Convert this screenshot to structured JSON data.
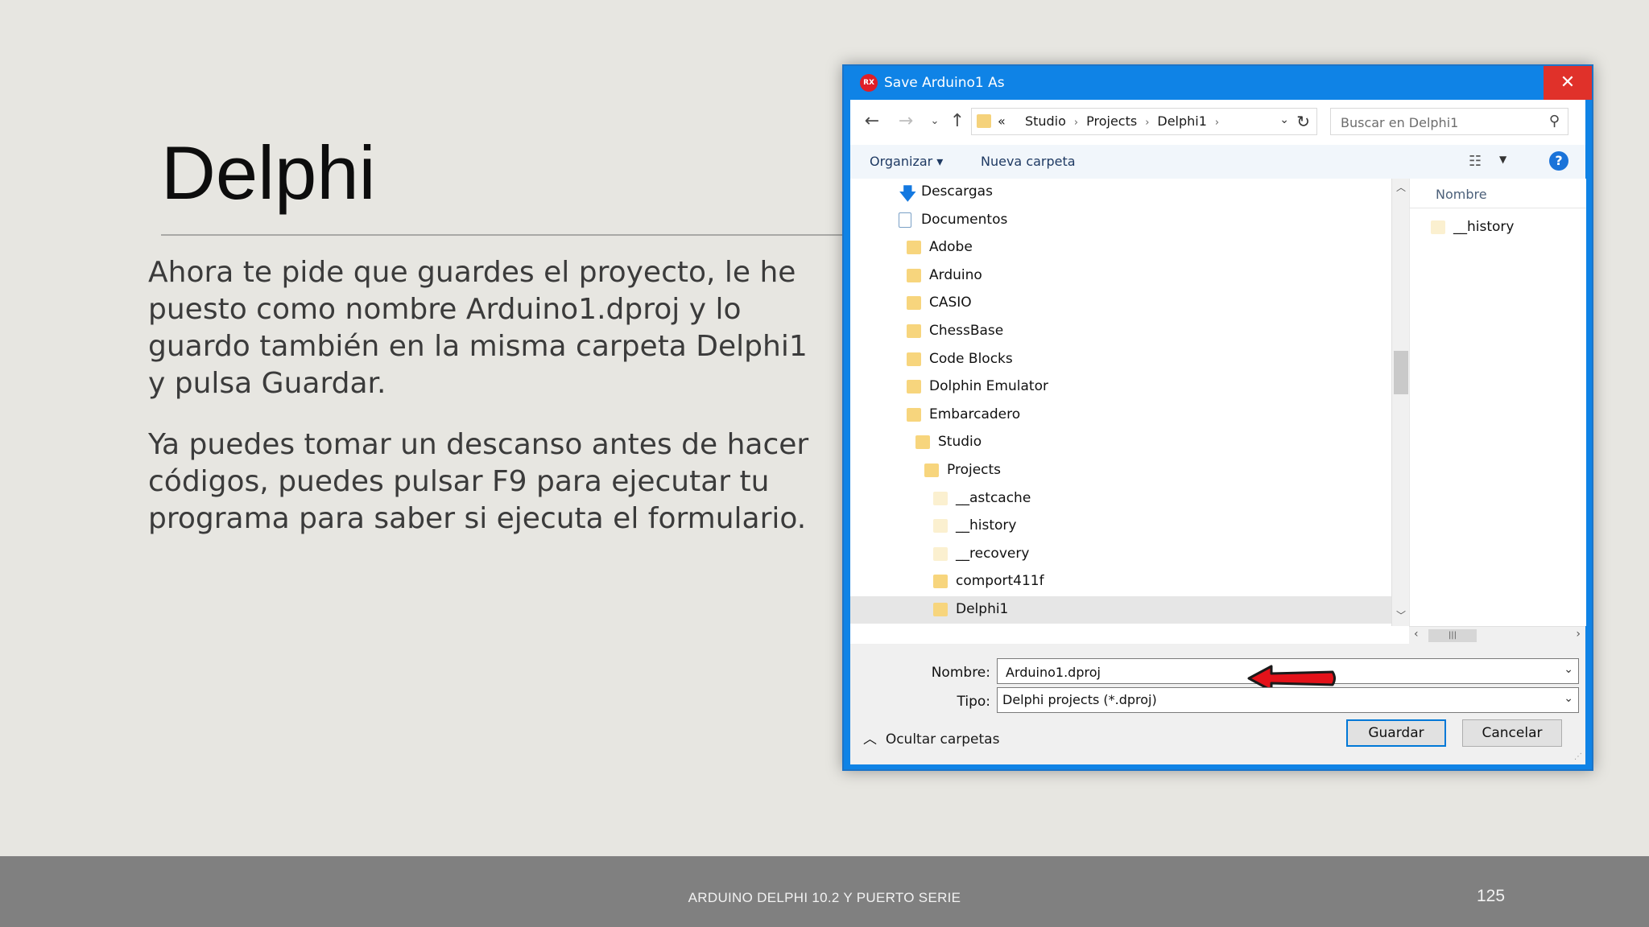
{
  "slide": {
    "title": "Delphi",
    "paragraph1": "Ahora te pide que guardes el proyecto, le he puesto como nombre Arduino1.dproj y lo guardo también en la misma carpeta Delphi1 y pulsa Guardar.",
    "paragraph2": "Ya puedes tomar un descanso antes de hacer códigos, puedes pulsar F9 para ejecutar tu programa para saber si ejecuta el formulario.",
    "footer": "ARDUINO DELPHI 10.2 Y PUERTO SERIE",
    "page_number": "125"
  },
  "dialog": {
    "app_icon_text": "RX",
    "title": "Save Arduino1 As",
    "close_glyph": "✕",
    "address": {
      "overflow": "«",
      "crumbs": [
        "Studio",
        "Projects",
        "Delphi1"
      ]
    },
    "search_placeholder": "Buscar en Delphi1",
    "toolbar": {
      "organize": "Organizar ▾",
      "new_folder": "Nueva carpeta",
      "help": "?"
    },
    "tree": [
      {
        "label": "Descargas",
        "icon": "download-icon",
        "indent": 0
      },
      {
        "label": "Documentos",
        "icon": "document-icon",
        "indent": 0
      },
      {
        "label": "Adobe",
        "icon": "folder-icon",
        "indent": 1
      },
      {
        "label": "Arduino",
        "icon": "folder-icon",
        "indent": 1
      },
      {
        "label": "CASIO",
        "icon": "folder-icon",
        "indent": 1
      },
      {
        "label": "ChessBase",
        "icon": "folder-icon",
        "indent": 1
      },
      {
        "label": "Code Blocks",
        "icon": "folder-icon",
        "indent": 1
      },
      {
        "label": "Dolphin Emulator",
        "icon": "folder-icon",
        "indent": 1
      },
      {
        "label": "Embarcadero",
        "icon": "folder-icon",
        "indent": 1
      },
      {
        "label": "Studio",
        "icon": "folder-icon",
        "indent": 2
      },
      {
        "label": "Projects",
        "icon": "folder-icon",
        "indent": 3
      },
      {
        "label": "__astcache",
        "icon": "hidden-folder-icon",
        "indent": 4
      },
      {
        "label": "__history",
        "icon": "hidden-folder-icon",
        "indent": 4
      },
      {
        "label": "__recovery",
        "icon": "hidden-folder-icon",
        "indent": 4
      },
      {
        "label": "comport411f",
        "icon": "folder-icon",
        "indent": 4
      },
      {
        "label": "Delphi1",
        "icon": "folder-icon",
        "indent": 4,
        "selected": true
      }
    ],
    "files": {
      "column_header": "Nombre",
      "rows": [
        {
          "label": "__history",
          "icon": "hidden-folder-icon"
        }
      ]
    },
    "filename_label": "Nombre:",
    "filename_value": "Arduino1.dproj",
    "type_label": "Tipo:",
    "type_value": "Delphi projects (*.dproj)",
    "hide_folders": "Ocultar carpetas",
    "save_button": "Guardar",
    "cancel_button": "Cancelar"
  },
  "colors": {
    "titlebar": "#0f83e6",
    "close": "#e0312a",
    "arrow": "#e3121a",
    "folder": "#f7d57d"
  }
}
